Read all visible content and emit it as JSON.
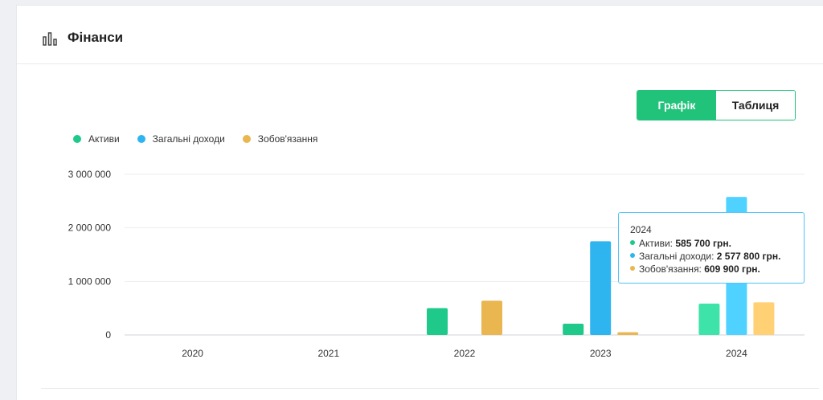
{
  "header": {
    "title": "Фінанси",
    "icon": "bar-chart-icon"
  },
  "toggle": {
    "graph_label": "Графік",
    "table_label": "Таблиця",
    "active": "graph"
  },
  "colors": {
    "assets": "#1ec98a",
    "income": "#2eb5f0",
    "liabilities": "#e9b64f",
    "accent": "#21c27a"
  },
  "tooltip": {
    "year": "2024",
    "rows": [
      {
        "label": "Активи: ",
        "value": "585 700 грн."
      },
      {
        "label": "Загальні доходи: ",
        "value": "2 577 800 грн."
      },
      {
        "label": "Зобов'язання: ",
        "value": "609 900 грн."
      }
    ]
  },
  "chart_data": {
    "type": "bar",
    "categories": [
      "2020",
      "2021",
      "2022",
      "2023",
      "2024"
    ],
    "series": [
      {
        "name": "Активи",
        "values": [
          0,
          0,
          500000,
          210000,
          585700
        ]
      },
      {
        "name": "Загальні доходи",
        "values": [
          0,
          0,
          0,
          1750000,
          2577800
        ]
      },
      {
        "name": "Зобов'язання",
        "values": [
          0,
          0,
          640000,
          50000,
          609900
        ]
      }
    ],
    "ylim": [
      0,
      3000000
    ],
    "yticks": [
      0,
      1000000,
      2000000,
      3000000
    ],
    "ytick_labels": [
      "0",
      "1 000 000",
      "2 000 000",
      "3 000 000"
    ],
    "grid": true,
    "legend": "top-left",
    "highlighted_category": "2024"
  }
}
